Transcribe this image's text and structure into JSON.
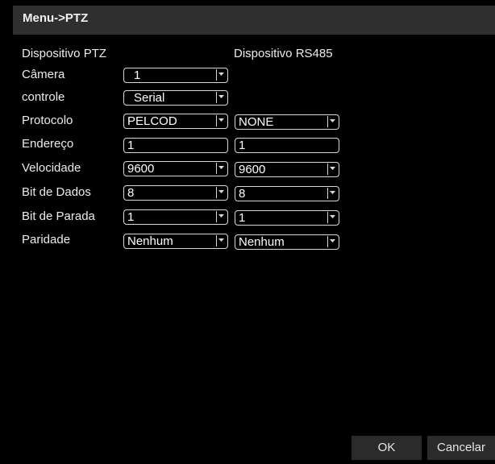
{
  "title": "Menu->PTZ",
  "columns": {
    "ptz_device": "Dispositivo PTZ",
    "rs485_device": "Dispositivo RS485"
  },
  "rows": {
    "camera": {
      "label": "Câmera",
      "ptz": "1"
    },
    "control": {
      "label": "controle",
      "ptz": "Serial"
    },
    "protocol": {
      "label": "Protocolo",
      "ptz": "PELCOD",
      "rs485": "NONE"
    },
    "address": {
      "label": "Endereço",
      "ptz": "1",
      "rs485": "1"
    },
    "speed": {
      "label": "Velocidade",
      "ptz": "9600",
      "rs485": "9600"
    },
    "data_bits": {
      "label": "Bit de Dados",
      "ptz": "8",
      "rs485": "8"
    },
    "stop_bits": {
      "label": "Bit de Parada",
      "ptz": "1",
      "rs485": "1"
    },
    "parity": {
      "label": "Paridade",
      "ptz": "Nenhum",
      "rs485": "Nenhum"
    }
  },
  "buttons": {
    "ok": "OK",
    "cancel": "Cancelar"
  },
  "colors": {
    "background": "#000000",
    "titlebar": "#2f2f2f",
    "button": "#2b2b2b",
    "border": "#d8d8d8"
  }
}
